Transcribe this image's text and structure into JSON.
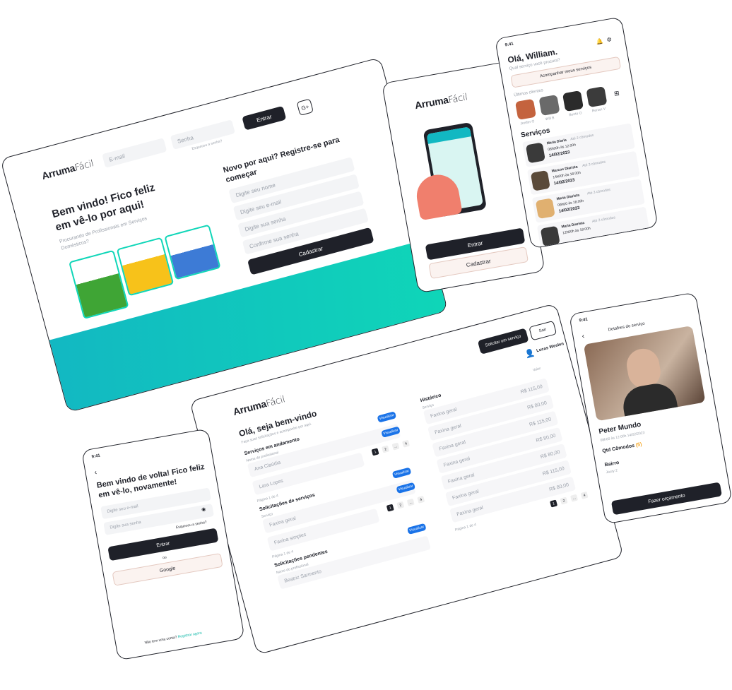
{
  "colors": {
    "dark": "#1f2129",
    "teal": "#0fd6b8",
    "blue": "#1a73e8",
    "light": "#fbf3f0",
    "orange": "#f5a623"
  },
  "brand": {
    "strong": "Arruma",
    "light": "Fácil"
  },
  "landing": {
    "email_placeholder": "E-mail",
    "password_placeholder": "Senha",
    "forgot": "Esqueceu a senha?",
    "enter": "Entrar",
    "google": "G+",
    "hero_title": "Bem vindo! Fico feliz em vê-lo por aqui!",
    "hero_subtitle": "Procurando de Profissionais em Serviços Domésticos?",
    "register_title": "Novo por aqui? Registre-se para começar",
    "name_placeholder": "Digite seu nome",
    "reg_email_placeholder": "Digite seu e-mail",
    "reg_password_placeholder": "Digite sua senha",
    "confirm_placeholder": "Confirme sua senha",
    "register_button": "Cadastrar"
  },
  "splash": {
    "enter": "Entrar",
    "register": "Cadastrar"
  },
  "home_phone": {
    "time": "9:41",
    "greeting": "Olá, William.",
    "question": "Qual serviço você procura?",
    "follow": "Acompanhar meus serviços",
    "recent": "Últimos clientes",
    "clients": [
      "Jenifer O",
      "Will B",
      "Bento O",
      "Renan V"
    ],
    "services_title": "Serviços",
    "services": [
      {
        "name": "Maria Diaria",
        "tag": "Até 2 cômodos",
        "time": "08h00h às 12.00h",
        "date": "14/02/2023"
      },
      {
        "name": "Marcos Diarista",
        "tag": "Até 3 cômodos",
        "time": "14h00h às 18.00h",
        "date": "14/02/2023"
      },
      {
        "name": "Maria Diarista",
        "tag": "Até 3 cômodos",
        "time": "09h00 às 18.00h",
        "date": "14/02/2023"
      },
      {
        "name": "Maria Diarista",
        "tag": "Até 3 cômodos",
        "time": "12h00h às 18.00h",
        "date": ""
      }
    ]
  },
  "dashboard": {
    "request": "Solicitar um serviço",
    "logout": "Sair",
    "user": "Lucas Weslen",
    "greeting": "Olá, seja bem-vindo",
    "subtitle": "Faça suas solicitações e acompanhe por aqui.",
    "in_progress": "Serviços em andamento",
    "professional_label": "Nome do profissional",
    "in_progress_rows": [
      "Ana Claúdia",
      "Lara Lopes"
    ],
    "view": "Visualizar",
    "page_info": "Página 1 de 4",
    "requests_title": "Solicitações de serviços",
    "service_label": "Serviço",
    "request_rows": [
      "Faxina geral",
      "Faxina simples"
    ],
    "pending_title": "Solicitações pendentes",
    "pending_rows": [
      "Beatriz Sarmento"
    ],
    "history": "Histórico",
    "value_label": "Valor",
    "history_rows": [
      {
        "service": "Faxina geral",
        "value": "R$ 115,00"
      },
      {
        "service": "Faxina geral",
        "value": "R$ 80,00"
      },
      {
        "service": "Faxina geral",
        "value": "R$ 115,00"
      },
      {
        "service": "Faxina geral",
        "value": "R$ 80,00"
      },
      {
        "service": "Faxina geral",
        "value": "R$ 80,00"
      },
      {
        "service": "Faxina geral",
        "value": "R$ 115,00"
      },
      {
        "service": "Faxina geral",
        "value": "R$ 80,00"
      }
    ],
    "pages": [
      "1",
      "2",
      "...",
      "4"
    ]
  },
  "login_phone": {
    "time": "9:41",
    "title": "Bem vindo de volta! Fico feliz em vê-lo, novamente!",
    "email_placeholder": "Digite seu e-mail",
    "password_placeholder": "Digite sua senha",
    "forgot": "Esqueceu a senha?",
    "enter": "Entrar",
    "or": "ou",
    "google": "Google",
    "no_account": "Não tem uma conta?",
    "register": "Registrar agora"
  },
  "details_phone": {
    "time": "9:41",
    "header": "Detalhes do serviço",
    "name": "Peter Mundo",
    "schedule": "08h00 às 12:00h  14/02/2023",
    "rooms_label": "Qtd Cômodos",
    "rooms_value": "(5)",
    "district_label": "Bairro",
    "district_value": "Jaury 2",
    "budget": "Fazer orçamento"
  }
}
